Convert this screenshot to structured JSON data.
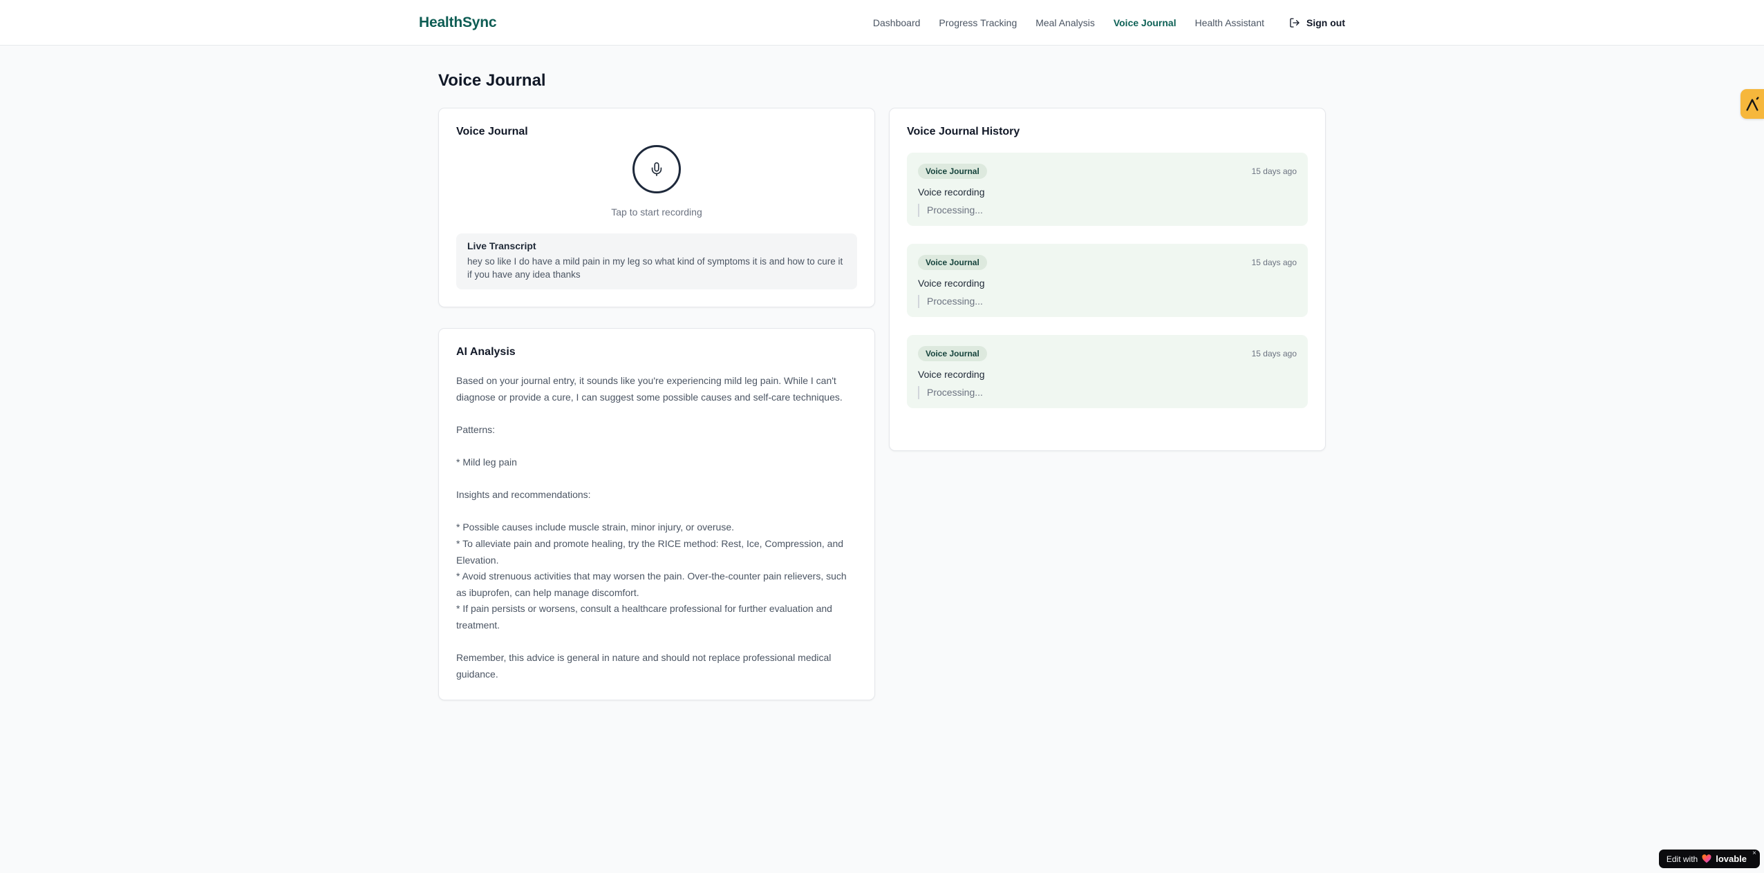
{
  "brand": {
    "name": "HealthSync"
  },
  "nav": {
    "items": [
      {
        "label": "Dashboard",
        "active": false
      },
      {
        "label": "Progress Tracking",
        "active": false
      },
      {
        "label": "Meal Analysis",
        "active": false
      },
      {
        "label": "Voice Journal",
        "active": true
      },
      {
        "label": "Health Assistant",
        "active": false
      }
    ],
    "sign_out_label": "Sign out"
  },
  "page": {
    "title": "Voice Journal"
  },
  "recorder_card": {
    "title": "Voice Journal",
    "tap_label": "Tap to start recording",
    "transcript": {
      "title": "Live Transcript",
      "text": "hey so like I do have a mild pain in my leg so what kind of symptoms it is and how to cure it if you have any idea thanks"
    }
  },
  "analysis_card": {
    "title": "AI Analysis",
    "body": "Based on your journal entry, it sounds like you're experiencing mild leg pain. While I can't diagnose or provide a cure, I can suggest some possible causes and self-care techniques.\n\nPatterns:\n\n* Mild leg pain\n\nInsights and recommendations:\n\n* Possible causes include muscle strain, minor injury, or overuse.\n* To alleviate pain and promote healing, try the RICE method: Rest, Ice, Compression, and Elevation.\n* Avoid strenuous activities that may worsen the pain. Over-the-counter pain relievers, such as ibuprofen, can help manage discomfort.\n* If pain persists or worsens, consult a healthcare professional for further evaluation and treatment.\n\nRemember, this advice is general in nature and should not replace professional medical guidance."
  },
  "history_card": {
    "title": "Voice Journal History",
    "items": [
      {
        "badge": "Voice Journal",
        "time": "15 days ago",
        "label": "Voice recording",
        "status": "Processing..."
      },
      {
        "badge": "Voice Journal",
        "time": "15 days ago",
        "label": "Voice recording",
        "status": "Processing..."
      },
      {
        "badge": "Voice Journal",
        "time": "15 days ago",
        "label": "Voice recording",
        "status": "Processing..."
      }
    ]
  },
  "badges": {
    "lovable": {
      "prefix": "Edit with",
      "brand": "lovable",
      "close": "×"
    }
  },
  "colors": {
    "brand_teal": "#0d5c53",
    "active_nav_teal": "#0e6156",
    "history_item_bg": "#f0f7f1",
    "history_badge_bg": "#dde9de",
    "amber_tab": "#f6b73c",
    "page_bg": "#f9fafb",
    "mic_ring": "#1e293b"
  }
}
